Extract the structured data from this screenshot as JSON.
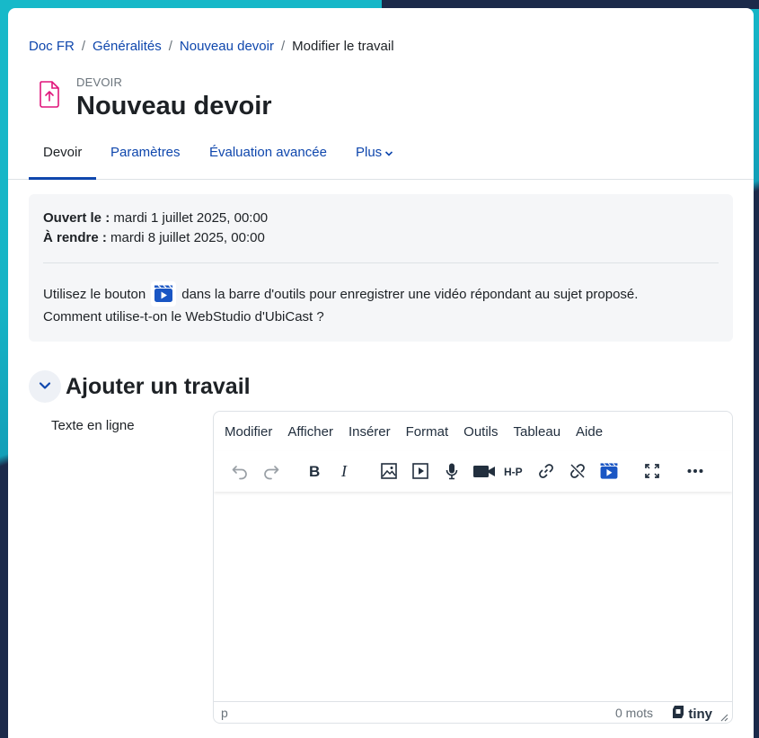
{
  "breadcrumb": {
    "items": [
      "Doc FR",
      "Généralités",
      "Nouveau devoir"
    ],
    "separator": "/",
    "current": "Modifier le travail"
  },
  "header": {
    "kicker": "DEVOIR",
    "title": "Nouveau devoir",
    "icon": "file-upload-icon",
    "icon_color": "#e0157b"
  },
  "tabs": [
    {
      "label": "Devoir",
      "active": true
    },
    {
      "label": "Paramètres"
    },
    {
      "label": "Évaluation avancée"
    },
    {
      "label": "Plus"
    }
  ],
  "info": {
    "opened_label": "Ouvert le :",
    "opened_value": "mardi 1 juillet 2025, 00:00",
    "due_label": "À rendre :",
    "due_value": "mardi 8 juillet 2025, 00:00",
    "instruction_before": "Utilisez le bouton",
    "instruction_after": "dans la barre d'outils pour enregistrer une vidéo répondant au sujet proposé.",
    "help_text": "Comment utilise-t-on le WebStudio d'UbiCast ?"
  },
  "section": {
    "title": "Ajouter un travail",
    "field_label": "Texte en ligne"
  },
  "editor": {
    "menu": [
      "Modifier",
      "Afficher",
      "Insérer",
      "Format",
      "Outils",
      "Tableau",
      "Aide"
    ],
    "toolbar_icons": [
      "undo-icon",
      "redo-icon",
      "bold-icon",
      "italic-icon",
      "image-icon",
      "media-icon",
      "microphone-icon",
      "video-camera-icon",
      "h5p-icon",
      "link-icon",
      "unlink-icon",
      "ubicast-icon",
      "fullscreen-icon",
      "more-icon"
    ],
    "h5p_label": "H-P",
    "status_path": "p",
    "word_count": "0 mots",
    "brand": "tiny"
  },
  "colors": {
    "link": "#0f47ad",
    "ubicast": "#1a56c4",
    "background_teal": "#17b9c9",
    "background_navy": "#1b2a4a"
  }
}
